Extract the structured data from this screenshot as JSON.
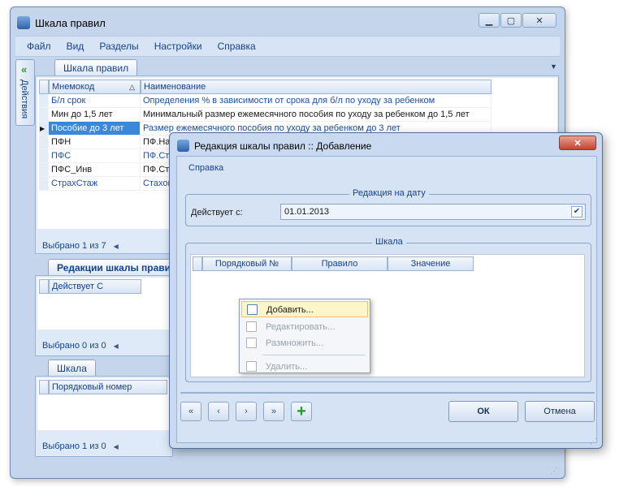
{
  "window": {
    "title": "Шкала правил",
    "controls": {
      "minimize": "▁",
      "maximize": "▢",
      "close": "✕"
    }
  },
  "menu": [
    "Файл",
    "Вид",
    "Разделы",
    "Настройки",
    "Справка"
  ],
  "side_tab": "Действия",
  "main_tab": "Шкала правил",
  "rules_grid": {
    "columns": [
      "Мнемокод",
      "Наименование"
    ],
    "rows": [
      {
        "code": "Б/л срок",
        "name": "Определения % в зависимости от срока для б/л по уходу за ребенком"
      },
      {
        "code": "Мин до 1,5 лет",
        "name": "Минимальный размер ежемесячного пособия по уходу за ребенком до 1,5 лет"
      },
      {
        "code": "Пособие до 3 лет",
        "name": "Размер ежемесячного пособия по уходу за ребенком до 3 лет"
      },
      {
        "code": "ПФН",
        "name": "ПФ.Нак"
      },
      {
        "code": "ПФС",
        "name": "ПФ.Стр"
      },
      {
        "code": "ПФС_Инв",
        "name": "ПФ.Стр"
      },
      {
        "code": "СтрахСтаж",
        "name": "Стахов"
      }
    ],
    "status": "Выбрано 1 из 7"
  },
  "revisions_panel": {
    "tab": "Редакции шкалы правил",
    "column": "Действует С",
    "status": "Выбрано 0 из 0"
  },
  "scale_panel": {
    "tab": "Шкала",
    "column": "Порядковый номер",
    "status": "Выбрано 1 из 0"
  },
  "dialog": {
    "title": "Редакция шкалы правил :: Добавление",
    "menu": "Справка",
    "group_date": "Редакция на дату",
    "valid_from_label": "Действует с:",
    "valid_from_value": "01.01.2013",
    "group_scale": "Шкала",
    "scale_columns": [
      "Порядковый №",
      "Правило",
      "Значение"
    ],
    "context_menu": [
      "Добавить...",
      "Редактировать...",
      "Размножить...",
      "Удалить..."
    ],
    "nav": [
      "«",
      "‹",
      "›",
      "»"
    ],
    "ok": "ОК",
    "cancel": "Отмена",
    "close": "✕"
  },
  "colors": {
    "accent": "#15428b",
    "selected_row": "#3b87d9"
  }
}
